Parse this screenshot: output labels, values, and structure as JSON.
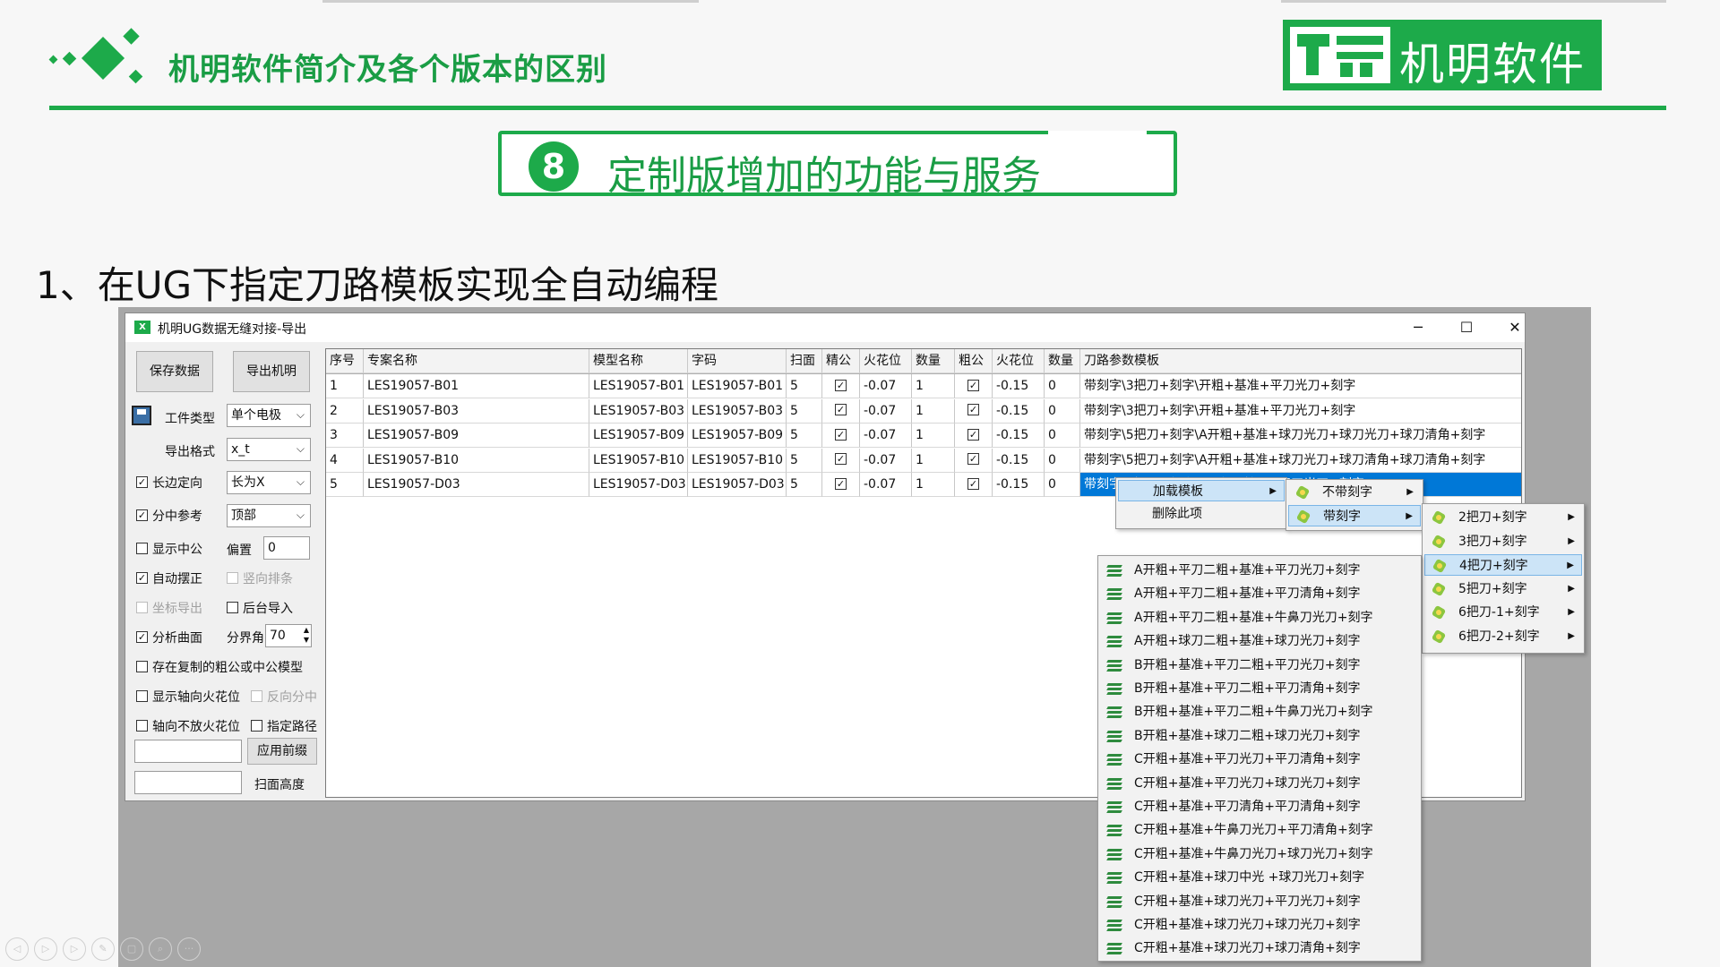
{
  "slide": {
    "title": "机明软件简介及各个版本的区别",
    "logo_text": "机明软件",
    "section_number": "8",
    "section_title": "定制版增加的功能与服务",
    "subheading": "1、在UG下指定刀路模板实现全自动编程",
    "accent_color": "#1daa4a"
  },
  "window": {
    "title": "机明UG数据无缝对接-导出",
    "app_icon": "excel-icon",
    "controls": {
      "minimize": "─",
      "maximize": "☐",
      "close": "✕"
    }
  },
  "left_panel": {
    "save_button": "保存数据",
    "export_button": "导出机明",
    "part_type_label": "工件类型",
    "part_type_value": "单个电极",
    "export_format_label": "导出格式",
    "export_format_value": "x_t",
    "long_edge_label": "长边定向",
    "long_edge_checked": true,
    "long_edge_value": "长为X",
    "center_ref_label": "分中参考",
    "center_ref_checked": true,
    "center_ref_value": "顶部",
    "show_center_label": "显示中公",
    "show_center_checked": false,
    "offset_label": "偏置",
    "offset_value": "0",
    "auto_align_label": "自动摆正",
    "auto_align_checked": true,
    "vertical_arrange_label": "竖向排条",
    "vertical_arrange_checked": false,
    "coord_export_label": "坐标导出",
    "coord_export_checked": false,
    "bg_import_label": "后台导入",
    "bg_import_checked": false,
    "analyze_surface_label": "分析曲面",
    "analyze_surface_checked": true,
    "boundary_angle_label": "分界角",
    "boundary_angle_value": "70",
    "copy_model_label": "存在复制的粗公或中公模型",
    "copy_model_checked": false,
    "show_axial_spark_label": "显示轴向火花位",
    "show_axial_spark_checked": false,
    "reverse_center_label": "反向分中",
    "reverse_center_checked": false,
    "no_axial_spark_label": "轴向不放火花位",
    "no_axial_spark_checked": false,
    "specify_path_label": "指定路径",
    "specify_path_checked": false,
    "prefix_value": "",
    "apply_prefix_button": "应用前缀",
    "scan_height_value": "",
    "scan_height_label": "扫面高度"
  },
  "table": {
    "columns": [
      "序号",
      "专案名称",
      "模型名称",
      "字码",
      "扫面",
      "精公",
      "火花位",
      "数量",
      "粗公",
      "火花位",
      "数量",
      "刀路参数模板"
    ],
    "rows": [
      [
        "1",
        "LES19057-B01",
        "LES19057-B01",
        "LES19057-B01",
        "5",
        true,
        "-0.07",
        "1",
        true,
        "-0.15",
        "0",
        "带刻字\\3把刀+刻字\\开粗+基准+平刀光刀+刻字"
      ],
      [
        "2",
        "LES19057-B03",
        "LES19057-B03",
        "LES19057-B03",
        "5",
        true,
        "-0.07",
        "1",
        true,
        "-0.15",
        "0",
        "带刻字\\3把刀+刻字\\开粗+基准+平刀光刀+刻字"
      ],
      [
        "3",
        "LES19057-B09",
        "LES19057-B09",
        "LES19057-B09",
        "5",
        true,
        "-0.07",
        "1",
        true,
        "-0.15",
        "0",
        "带刻字\\5把刀+刻字\\A开粗+基准+球刀光刀+球刀光刀+球刀清角+刻字"
      ],
      [
        "4",
        "LES19057-B10",
        "LES19057-B10",
        "LES19057-B10",
        "5",
        true,
        "-0.07",
        "1",
        true,
        "-0.15",
        "0",
        "带刻字\\5把刀+刻字\\A开粗+基准+球刀光刀+球刀清角+球刀清角+刻字"
      ],
      [
        "5",
        "LES19057-D03",
        "LES19057-D03",
        "LES19057-D03",
        "5",
        true,
        "-0.07",
        "1",
        true,
        "-0.15",
        "0",
        "带刻字\\4把刀+刻字\\C开粗+基准+平刀光刀+刻字"
      ]
    ],
    "selected_row": 4
  },
  "context_menu": {
    "items": [
      "加载模板",
      "删除此项"
    ],
    "submenu1": [
      "不带刻字",
      "带刻字"
    ],
    "submenu2": [
      "2把刀+刻字",
      "3把刀+刻字",
      "4把刀+刻字",
      "5把刀+刻字",
      "6把刀-1+刻字",
      "6把刀-2+刻字"
    ],
    "submenu3": [
      "A开粗+平刀二粗+基准+平刀光刀+刻字",
      "A开粗+平刀二粗+基准+平刀清角+刻字",
      "A开粗+平刀二粗+基准+牛鼻刀光刀+刻字",
      "A开粗+球刀二粗+基准+球刀光刀+刻字",
      "B开粗+基准+平刀二粗+平刀光刀+刻字",
      "B开粗+基准+平刀二粗+平刀清角+刻字",
      "B开粗+基准+平刀二粗+牛鼻刀光刀+刻字",
      "B开粗+基准+球刀二粗+球刀光刀+刻字",
      "C开粗+基准+平刀光刀+平刀清角+刻字",
      "C开粗+基准+平刀光刀+球刀光刀+刻字",
      "C开粗+基准+平刀清角+平刀清角+刻字",
      "C开粗+基准+牛鼻刀光刀+平刀清角+刻字",
      "C开粗+基准+牛鼻刀光刀+球刀光刀+刻字",
      "C开粗+基准+球刀中光 +球刀光刀+刻字",
      "C开粗+基准+球刀光刀+平刀光刀+刻字",
      "C开粗+基准+球刀光刀+球刀光刀+刻字",
      "C开粗+基准+球刀光刀+球刀清角+刻字"
    ]
  },
  "player_controls": [
    "◁",
    "▷",
    "▷",
    "✎",
    "▢",
    "⌕",
    "···"
  ]
}
